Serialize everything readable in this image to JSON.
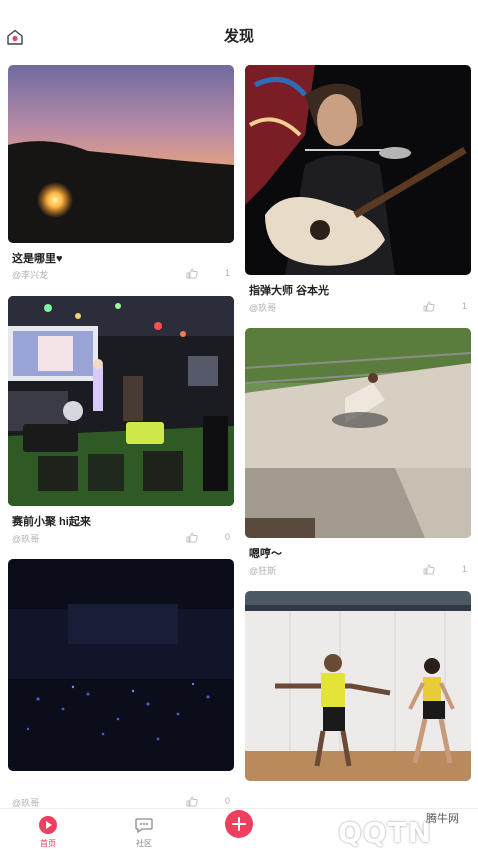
{
  "header": {
    "title": "发现"
  },
  "feed": {
    "left": [
      {
        "caption": "这是哪里♥",
        "author": "@李兴龙",
        "likes": "1"
      },
      {
        "caption": "赛前小聚 hi起来",
        "author": "@玖哥",
        "likes": "0"
      },
      {
        "caption": "",
        "author": "@玖哥",
        "likes": "0"
      }
    ],
    "right": [
      {
        "caption": "指弹大师 谷本光",
        "author": "@玖哥",
        "likes": "1"
      },
      {
        "caption": "嗯哼～",
        "author": "@狂斯",
        "likes": "1"
      },
      {
        "caption": "",
        "author": "",
        "likes": ""
      }
    ]
  },
  "tabbar": {
    "tabs": [
      {
        "label": "首页",
        "active": true
      },
      {
        "label": "社区",
        "active": false
      }
    ]
  },
  "watermark": {
    "text": "QQTN",
    "site": "腾牛网"
  },
  "colors": {
    "accent": "#f03e5f",
    "muted": "#b0b0b0"
  }
}
